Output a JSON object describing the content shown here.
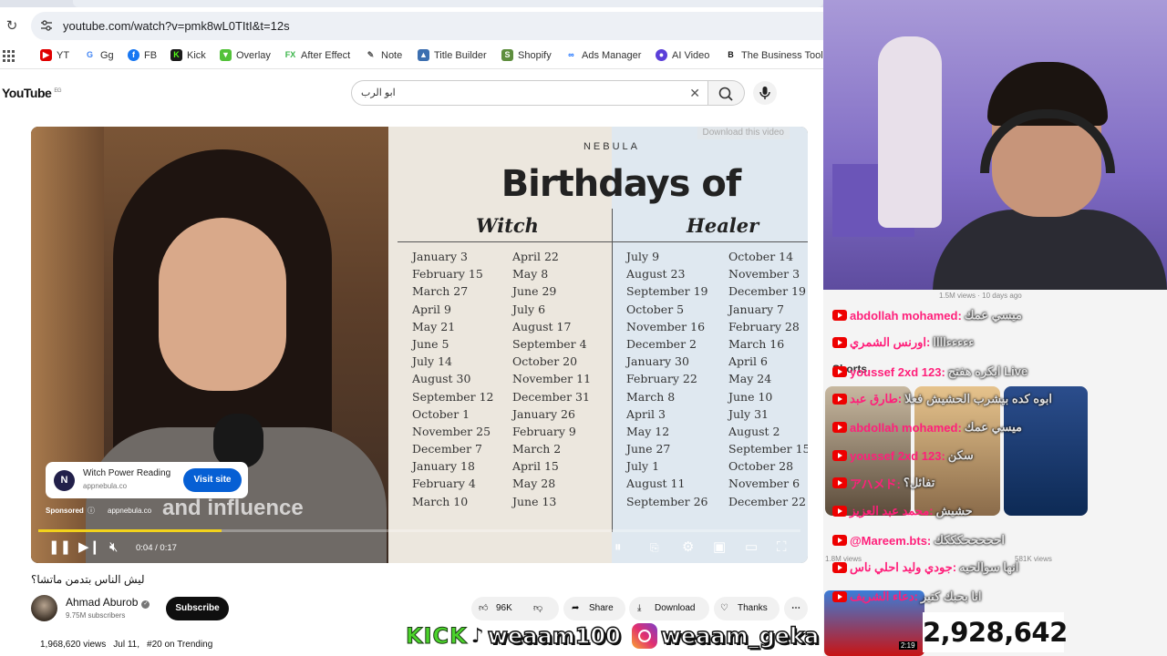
{
  "browser": {
    "url": "youtube.com/watch?v=pmk8wL0TItI&t=12s",
    "bookmarks": [
      {
        "label": "YT",
        "icon": "youtube-icon",
        "color": "#e00000"
      },
      {
        "label": "Gg",
        "icon": "google-icon",
        "color": "#4285f4"
      },
      {
        "label": "FB",
        "icon": "facebook-icon",
        "color": "#1877f2"
      },
      {
        "label": "Kick",
        "icon": "kick-icon",
        "color": "#1b1b1b"
      },
      {
        "label": "Overlay",
        "icon": "overlay-icon",
        "color": "#53c23a"
      },
      {
        "label": "After Effect",
        "icon": "fx-icon",
        "color": "#3bb54a"
      },
      {
        "label": "Note",
        "icon": "note-icon",
        "color": "#555555"
      },
      {
        "label": "Title Builder",
        "icon": "title-builder-icon",
        "color": "#3c6fb0"
      },
      {
        "label": "Shopify",
        "icon": "shopify-icon",
        "color": "#5e8e3e"
      },
      {
        "label": "Ads Manager",
        "icon": "meta-icon",
        "color": "#0866ff"
      },
      {
        "label": "AI Video",
        "icon": "ai-video-icon",
        "color": "#5b3fd9"
      },
      {
        "label": "The Business Tool",
        "icon": "business-tool-icon",
        "color": "#111111"
      }
    ]
  },
  "youtube": {
    "logo": "YouTube",
    "region": "EG",
    "search_query": "ابو الرب"
  },
  "video": {
    "brand": "NEBULA",
    "title": "Birthdays of",
    "witch_heading": "Witch",
    "healer_heading": "Healer",
    "download_label": "Download this video",
    "columns": [
      [
        "January 3",
        "February 15",
        "March 27",
        "April 9",
        "May 21",
        "June 5",
        "July 14",
        "August 30",
        "September 12",
        "October 1",
        "November 25",
        "December 7",
        "January 18",
        "February 4",
        "March 10"
      ],
      [
        "April 22",
        "May 8",
        "June 29",
        "July 6",
        "August 17",
        "September 4",
        "October 20",
        "November 11",
        "December 31",
        "January 26",
        "February 9",
        "March 2",
        "April 15",
        "May 28",
        "June 13"
      ],
      [
        "July 9",
        "August 23",
        "September 19",
        "October 5",
        "November 16",
        "December 2",
        "January 30",
        "February 22",
        "March 8",
        "April 3",
        "May 12",
        "June 27",
        "July 1",
        "August 11",
        "September 26"
      ],
      [
        "October 14",
        "November 3",
        "December 19",
        "January 7",
        "February 28",
        "March 16",
        "April 6",
        "May 24",
        "June 10",
        "July 31",
        "August 2",
        "September 15",
        "October 28",
        "November 6",
        "December 22"
      ]
    ],
    "caption": "and influence",
    "ad": {
      "title": "Witch Power Reading",
      "domain": "appnebula.co",
      "button": "Visit site",
      "sponsored": "Sponsored",
      "sponsored_domain": "appnebula.co"
    },
    "time": "0:04 / 0:17",
    "progress_fraction": 0.24
  },
  "info": {
    "title": "ليش الناس بتدمن ماتشا؟",
    "channel": "Ahmad Aburob",
    "subscribers": "9.75M subscribers",
    "subscribe": "Subscribe",
    "likes": "96K",
    "share": "Share",
    "download": "Download",
    "thanks": "Thanks",
    "views": "1,968,620 views",
    "date": "Jul 11,",
    "trending": "#20 on Trending"
  },
  "chat": {
    "messages": [
      {
        "user": "abdollah mohamed:",
        "text": "ميسي عمك"
      },
      {
        "user": "اورنس الشمري:",
        "text": "ءءءءءاااا"
      },
      {
        "user": "youssef 2xd 123:",
        "text": "ابكره هفتح Live"
      },
      {
        "user": "طارق عبد:",
        "text": "ابوه كده بيشرب الحشيش فعلا"
      },
      {
        "user": "abdollah mohamed:",
        "text": "ميسي عمك"
      },
      {
        "user": "youssef 2xd 123:",
        "text": "سكن"
      },
      {
        "user": "アハメド:",
        "text": "تفائل؟"
      },
      {
        "user": "محمد عبد العزيز:",
        "text": "حشيش"
      },
      {
        "user": "@Mareem.bts:",
        "text": "احححححكككك"
      },
      {
        "user": "جودي وليد احلي ناس:",
        "text": "انها سوالحيه"
      },
      {
        "user": "دعاء الشريف:",
        "text": "انا بحبك كتير"
      }
    ],
    "shorts_label": "Shorts",
    "sidebar_views_1": "1.5M views · 10 days ago",
    "sidebar_views_2": "581K views",
    "sidebar_views_3": "1.8M views",
    "live_duration": "2:19",
    "follower_count": "2,928,642"
  },
  "social": {
    "kick": "KICK",
    "tiktok_handle": "weaam100",
    "instagram_handle": "weaam_geka"
  }
}
